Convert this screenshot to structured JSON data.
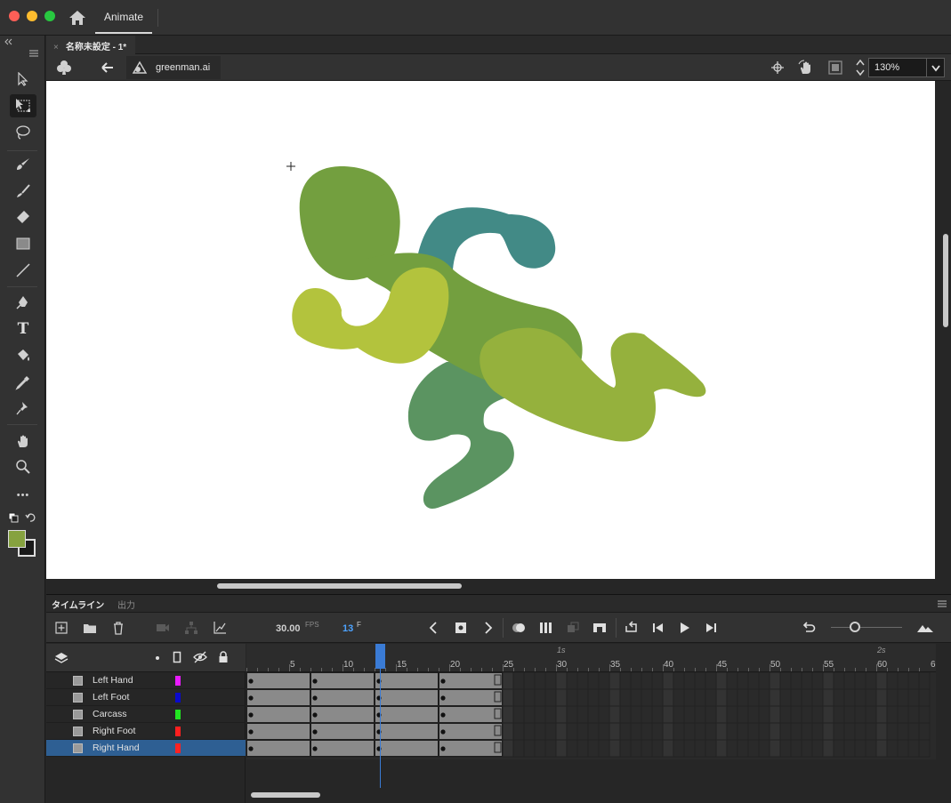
{
  "window": {
    "app_tab": "Animate"
  },
  "document": {
    "tab_title": "名称未設定 - 1*",
    "close_glyph": "×"
  },
  "edit_bar": {
    "symbol_name": "greenman.ai",
    "zoom": "130%"
  },
  "toolbar": {
    "tools": [
      "selection-tool",
      "free-transform-tool",
      "lasso-tool",
      "paint-brush-tool",
      "brush-tool",
      "eraser-tool",
      "rectangle-tool",
      "line-tool",
      "pen-tool",
      "text-tool",
      "paint-bucket-tool",
      "eyedropper-tool",
      "asset-warp-tool",
      "hand-tool",
      "zoom-tool",
      "more-tools"
    ],
    "text_tool_glyph": "T",
    "more_glyph": "•••",
    "fill_color": "#86a23f",
    "stroke_color": "#1a1a1a"
  },
  "timeline": {
    "tab_label": "タイムライン",
    "output_tab_label": "出力",
    "fps_value": "30.00",
    "fps_label": "FPS",
    "current_frame": "13",
    "frame_label": "F",
    "ruler_numbers": [
      "5",
      "10",
      "15",
      "20",
      "25",
      "30",
      "35",
      "40",
      "45",
      "50",
      "55",
      "60",
      "6"
    ],
    "ruler_seconds": [
      "1s",
      "2s"
    ],
    "layers": [
      {
        "name": "Left Hand",
        "color": "#e91bff",
        "selected": false
      },
      {
        "name": "Left Foot",
        "color": "#0a0acc",
        "selected": false
      },
      {
        "name": "Carcass",
        "color": "#21e521",
        "selected": false
      },
      {
        "name": "Right Foot",
        "color": "#ff1f1f",
        "selected": false
      },
      {
        "name": "Right Hand",
        "color": "#ff2222",
        "selected": true
      }
    ],
    "keyframes": [
      1,
      7,
      13,
      19,
      25
    ],
    "total_frames": 24
  },
  "character_colors": {
    "head_and_body": "#739f3f",
    "back_arm": "#428a86",
    "front_arm": "#b3c33d",
    "back_leg": "#5b9461",
    "front_leg": "#95b13d"
  }
}
